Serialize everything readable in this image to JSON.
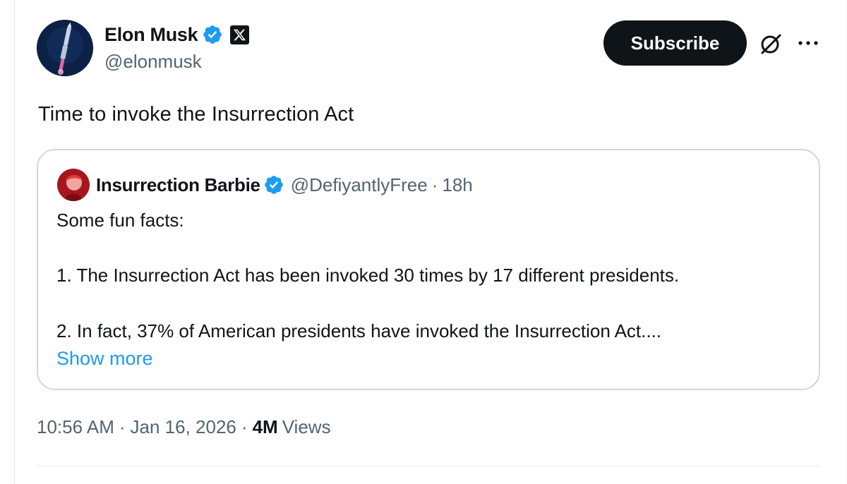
{
  "author": {
    "name": "Elon Musk",
    "handle": "@elonmusk",
    "verified_color": "#1d9bf0",
    "badge_icon": "x-logo-icon"
  },
  "header": {
    "subscribe_label": "Subscribe",
    "grok_icon": "grok-icon",
    "more_icon": "more-icon"
  },
  "tweet": {
    "text": "Time to invoke the Insurrection Act"
  },
  "quote": {
    "name": "Insurrection Barbie",
    "handle": "@DefiyantlyFree",
    "separator": "·",
    "time": "18h",
    "lines": [
      "Some fun facts:",
      "1. The Insurrection Act has been invoked 30 times by 17 different presidents.",
      "2. In fact, 37% of American presidents have invoked the Insurrection Act...."
    ],
    "show_more": "Show more",
    "link_color": "#1d9bf0"
  },
  "meta": {
    "time": "10:56 AM",
    "separator": "·",
    "date": "Jan 16, 2026",
    "views_count": "4M",
    "views_label": "Views"
  }
}
